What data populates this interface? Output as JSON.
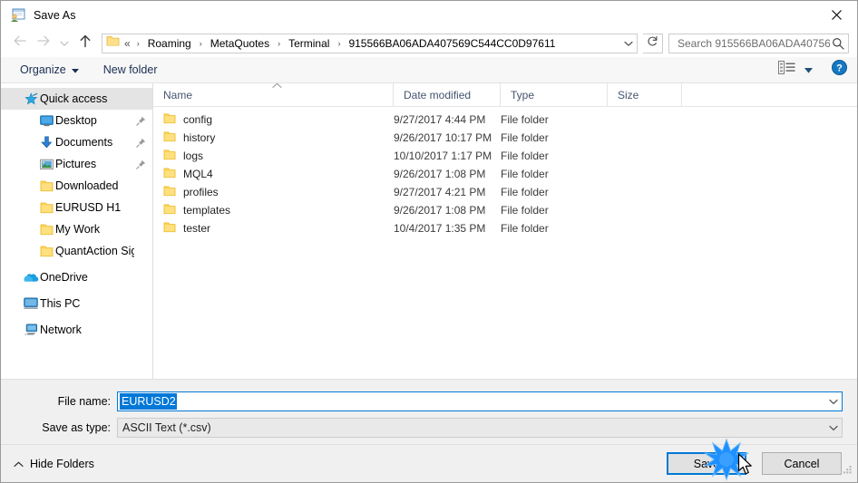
{
  "window": {
    "title": "Save As",
    "title_icon": "save-as-window-icon",
    "close_icon": "close-icon"
  },
  "nav": {
    "back_icon": "arrow-left-icon",
    "forward_icon": "arrow-right-icon",
    "recent_icon": "chevron-down-icon",
    "up_icon": "arrow-up-icon",
    "address_folder_icon": "folder-icon",
    "address_prefix": "«",
    "breadcrumbs": [
      "Roaming",
      "MetaQuotes",
      "Terminal",
      "915566BA06ADA407569C544CC0D97611"
    ],
    "separator": "›",
    "dropdown_icon": "chevron-down-icon",
    "refresh_icon": "refresh-icon"
  },
  "search": {
    "placeholder": "Search 915566BA06ADA40756...",
    "value": "",
    "icon": "search-icon"
  },
  "commandbar": {
    "organize_label": "Organize",
    "organize_caret_icon": "caret-down-icon",
    "new_folder_label": "New folder",
    "view_icon": "view-layout-icon",
    "view_caret_icon": "caret-down-icon",
    "help_icon": "help-circle-icon"
  },
  "sidebar": {
    "items": [
      {
        "label": "Quick access",
        "icon": "star-pin-icon",
        "level": 0,
        "selected": true,
        "pinned": false
      },
      {
        "label": "Desktop",
        "icon": "desktop-icon",
        "level": 1,
        "selected": false,
        "pinned": true
      },
      {
        "label": "Documents",
        "icon": "documents-icon",
        "level": 1,
        "selected": false,
        "pinned": true
      },
      {
        "label": "Pictures",
        "icon": "pictures-icon",
        "level": 1,
        "selected": false,
        "pinned": true
      },
      {
        "label": "Downloaded",
        "icon": "folder-icon",
        "level": 1,
        "selected": false,
        "pinned": false
      },
      {
        "label": "EURUSD H1",
        "icon": "folder-icon",
        "level": 1,
        "selected": false,
        "pinned": false
      },
      {
        "label": "My Work",
        "icon": "folder-icon",
        "level": 1,
        "selected": false,
        "pinned": false
      },
      {
        "label": "QuantAction Signal",
        "icon": "folder-icon",
        "level": 1,
        "selected": false,
        "pinned": false
      },
      {
        "label": "OneDrive",
        "icon": "onedrive-icon",
        "level": 0,
        "selected": false,
        "pinned": false,
        "gap_before": true
      },
      {
        "label": "This PC",
        "icon": "this-pc-icon",
        "level": 0,
        "selected": false,
        "pinned": false,
        "gap_before": true
      },
      {
        "label": "Network",
        "icon": "network-icon",
        "level": 0,
        "selected": false,
        "pinned": false,
        "gap_before": true
      }
    ]
  },
  "filelist": {
    "columns": [
      "Name",
      "Date modified",
      "Type",
      "Size"
    ],
    "sort_column": "Name",
    "sort_direction": "ascending",
    "sort_icon": "chevron-up-icon",
    "rows": [
      {
        "name": "config",
        "date": "9/27/2017 4:44 PM",
        "type": "File folder",
        "size": "",
        "icon": "folder-icon"
      },
      {
        "name": "history",
        "date": "9/26/2017 10:17 PM",
        "type": "File folder",
        "size": "",
        "icon": "folder-icon"
      },
      {
        "name": "logs",
        "date": "10/10/2017 1:17 PM",
        "type": "File folder",
        "size": "",
        "icon": "folder-icon"
      },
      {
        "name": "MQL4",
        "date": "9/26/2017 1:08 PM",
        "type": "File folder",
        "size": "",
        "icon": "folder-icon"
      },
      {
        "name": "profiles",
        "date": "9/27/2017 4:21 PM",
        "type": "File folder",
        "size": "",
        "icon": "folder-icon"
      },
      {
        "name": "templates",
        "date": "9/26/2017 1:08 PM",
        "type": "File folder",
        "size": "",
        "icon": "folder-icon"
      },
      {
        "name": "tester",
        "date": "10/4/2017 1:35 PM",
        "type": "File folder",
        "size": "",
        "icon": "folder-icon"
      }
    ]
  },
  "form": {
    "filename_label": "File name:",
    "filename_value": "EURUSD2",
    "filename_selected": true,
    "filetype_label": "Save as type:",
    "filetype_value": "ASCII Text (*.csv)",
    "combo_arrow_icon": "chevron-down-icon"
  },
  "footer": {
    "hide_folders_label": "Hide Folders",
    "hide_folders_icon": "chevron-up-icon",
    "save_label": "Save",
    "cancel_label": "Cancel",
    "resize_grip_icon": "resize-grip-icon",
    "cursor_icon": "mouse-pointer-icon",
    "click_effect_icon": "click-burst-icon"
  },
  "colors": {
    "accent": "#0078d7",
    "folder_yellow": "#fcd667",
    "selection_blue": "#0078d7",
    "sidebar_selected": "#e4e4e4",
    "header_text": "#44546f",
    "panel_bg": "#f0f0f0"
  }
}
